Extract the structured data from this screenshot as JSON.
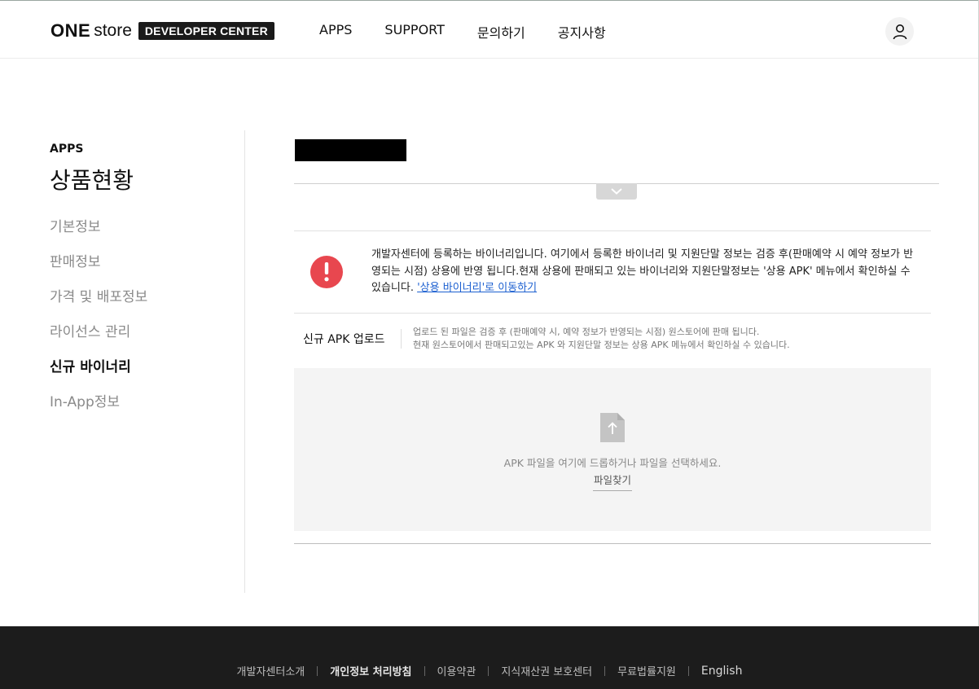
{
  "header": {
    "logo_one": "ONE",
    "logo_store": "store",
    "logo_badge": "DEVELOPER CENTER",
    "nav": [
      "APPS",
      "SUPPORT",
      "문의하기",
      "공지사항"
    ],
    "user_icon": "user-icon"
  },
  "sidebar": {
    "category": "APPS",
    "title": "상품현황",
    "items": [
      {
        "label": "기본정보",
        "active": false
      },
      {
        "label": "판매정보",
        "active": false
      },
      {
        "label": "가격 및 배포정보",
        "active": false
      },
      {
        "label": "라이선스 관리",
        "active": false
      },
      {
        "label": "신규 바이너리",
        "active": true
      },
      {
        "label": "In-App정보",
        "active": false
      }
    ]
  },
  "main": {
    "collapse_icon": "chevron-down-icon",
    "notice": {
      "icon": "alert-icon",
      "text": "개발자센터에 등록하는 바이너리입니다. 여기에서 등록한 바이너리 및 지원단말 정보는 검증 후(판매예약 시 예약 정보가 반영되는 시점) 상용에 반영 됩니다.현재 상용에 판매되고 있는 바이너리와 지원단말정보는 '상용 APK' 메뉴에서 확인하실 수 있습니다. ",
      "link": "'상용 바이너리'로 이동하기"
    },
    "upload": {
      "label": "신규 APK 업로드",
      "desc_line1": "업로드 된 파일은 검증 후 (판매예약 시, 예약 정보가 반영되는 시점) 원스토어에 판매 됩니다.",
      "desc_line2": "현재 원스토어에서 판매되고있는 APK 와 지원단말 정보는 상용 APK 메뉴에서 확인하실 수 있습니다.",
      "drop_text": "APK 파일을 여기에 드롭하거나 파일을 선택하세요.",
      "find_button": "파일찾기",
      "file_icon": "file-upload-icon"
    }
  },
  "footer": {
    "links": [
      "개발자센터소개",
      "개인정보 처리방침",
      "이용약관",
      "지식재산권 보호센터",
      "무료법률지원",
      "English"
    ]
  },
  "colors": {
    "alert_red": "#e8474f",
    "link_blue": "#1b5fd0",
    "footer_bg": "#1c1c1c"
  }
}
